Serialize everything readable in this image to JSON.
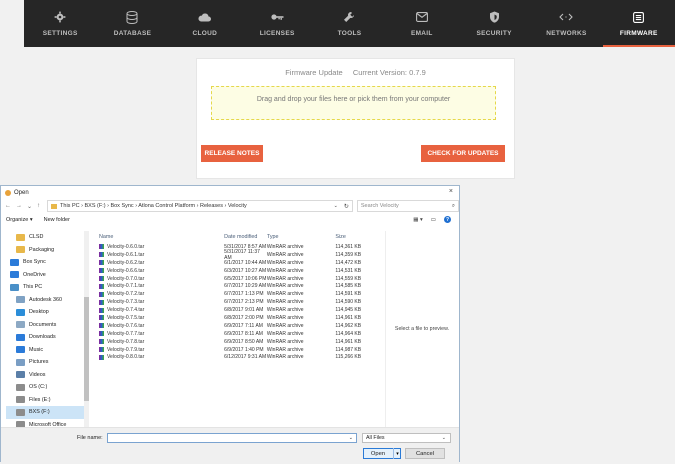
{
  "nav": {
    "items": [
      {
        "label": "SETTINGS",
        "icon": "gear-icon"
      },
      {
        "label": "DATABASE",
        "icon": "database-icon"
      },
      {
        "label": "CLOUD",
        "icon": "cloud-icon"
      },
      {
        "label": "LICENSES",
        "icon": "key-icon"
      },
      {
        "label": "TOOLS",
        "icon": "wrench-icon"
      },
      {
        "label": "EMAIL",
        "icon": "envelope-icon"
      },
      {
        "label": "SECURITY",
        "icon": "shield-icon"
      },
      {
        "label": "NETWORKS",
        "icon": "code-arrows-icon"
      },
      {
        "label": "FIRMWARE",
        "icon": "chip-icon"
      }
    ],
    "active": "FIRMWARE",
    "accent": "#e8623f"
  },
  "firmware": {
    "title": "Firmware Update",
    "version_label": "Current Version: 0.7.9",
    "drop_text": "Drag and drop your files here or pick them from your computer",
    "release_notes": "RELEASE NOTES",
    "check_updates": "CHECK FOR UPDATES"
  },
  "dialog": {
    "title": "Open",
    "close": "×",
    "breadcrumb": "This PC  ›  BXS (F:)  ›  Box Sync  ›  Atlona Control Platform  ›  Releases  ›  Velocity",
    "search_placeholder": "Search Velocity",
    "organize": "Organize ▾",
    "new_folder": "New folder",
    "nav_pane": [
      {
        "label": "CLSD",
        "icon": "folder-icon",
        "color": "#e8b84a",
        "indent": true
      },
      {
        "label": "Packaging",
        "icon": "folder-icon",
        "color": "#e8b84a",
        "indent": true
      },
      {
        "label": "Box Sync",
        "icon": "box-icon",
        "color": "#2b7bd9",
        "indent": false
      },
      {
        "label": "OneDrive",
        "icon": "onedrive-icon",
        "color": "#2b7bd9",
        "indent": false
      },
      {
        "label": "This PC",
        "icon": "pc-icon",
        "color": "#4a90c8",
        "indent": false
      },
      {
        "label": "Autodesk 360",
        "icon": "cloud-icon",
        "color": "#7fa2c4",
        "indent": true
      },
      {
        "label": "Desktop",
        "icon": "desktop-icon",
        "color": "#2b8ed9",
        "indent": true
      },
      {
        "label": "Documents",
        "icon": "documents-icon",
        "color": "#8da9c4",
        "indent": true
      },
      {
        "label": "Downloads",
        "icon": "downloads-icon",
        "color": "#2b7bd9",
        "indent": true
      },
      {
        "label": "Music",
        "icon": "music-icon",
        "color": "#2b7bd9",
        "indent": true
      },
      {
        "label": "Pictures",
        "icon": "pictures-icon",
        "color": "#7a9ec4",
        "indent": true
      },
      {
        "label": "Videos",
        "icon": "videos-icon",
        "color": "#5b7fa8",
        "indent": true
      },
      {
        "label": "OS (C:)",
        "icon": "drive-icon",
        "color": "#8c8c8c",
        "indent": true
      },
      {
        "label": "Files (E:)",
        "icon": "drive-icon",
        "color": "#8c8c8c",
        "indent": true
      },
      {
        "label": "BXS (F:)",
        "icon": "drive-icon",
        "color": "#8c8c8c",
        "indent": true,
        "selected": true
      },
      {
        "label": "Microsoft Office",
        "icon": "drive-icon",
        "color": "#8c8c8c",
        "indent": true
      }
    ],
    "columns": {
      "name": "Name",
      "date": "Date modified",
      "type": "Type",
      "size": "Size"
    },
    "files": [
      {
        "name": "Velocity-0.6.0.tar",
        "date": "5/31/2017 8:57 AM",
        "type": "WinRAR archive",
        "size": "114,361 KB"
      },
      {
        "name": "Velocity-0.6.1.tar",
        "date": "5/31/2017 11:37 AM",
        "type": "WinRAR archive",
        "size": "114,359 KB"
      },
      {
        "name": "Velocity-0.6.2.tar",
        "date": "6/1/2017 10:44 AM",
        "type": "WinRAR archive",
        "size": "114,472 KB"
      },
      {
        "name": "Velocity-0.6.6.tar",
        "date": "6/3/2017 10:27 AM",
        "type": "WinRAR archive",
        "size": "114,531 KB"
      },
      {
        "name": "Velocity-0.7.0.tar",
        "date": "6/5/2017 10:06 PM",
        "type": "WinRAR archive",
        "size": "114,559 KB"
      },
      {
        "name": "Velocity-0.7.1.tar",
        "date": "6/7/2017 10:29 AM",
        "type": "WinRAR archive",
        "size": "114,585 KB"
      },
      {
        "name": "Velocity-0.7.2.tar",
        "date": "6/7/2017 1:13 PM",
        "type": "WinRAR archive",
        "size": "114,591 KB"
      },
      {
        "name": "Velocity-0.7.3.tar",
        "date": "6/7/2017 2:13 PM",
        "type": "WinRAR archive",
        "size": "114,590 KB"
      },
      {
        "name": "Velocity-0.7.4.tar",
        "date": "6/8/2017 9:01 AM",
        "type": "WinRAR archive",
        "size": "114,945 KB"
      },
      {
        "name": "Velocity-0.7.5.tar",
        "date": "6/8/2017 2:00 PM",
        "type": "WinRAR archive",
        "size": "114,961 KB"
      },
      {
        "name": "Velocity-0.7.6.tar",
        "date": "6/9/2017 7:11 AM",
        "type": "WinRAR archive",
        "size": "114,962 KB"
      },
      {
        "name": "Velocity-0.7.7.tar",
        "date": "6/9/2017 8:11 AM",
        "type": "WinRAR archive",
        "size": "114,964 KB"
      },
      {
        "name": "Velocity-0.7.8.tar",
        "date": "6/9/2017 8:50 AM",
        "type": "WinRAR archive",
        "size": "114,961 KB"
      },
      {
        "name": "Velocity-0.7.9.tar",
        "date": "6/9/2017 1:40 PM",
        "type": "WinRAR archive",
        "size": "114,987 KB"
      },
      {
        "name": "Velocity-0.8.0.tar",
        "date": "6/12/2017 9:31 AM",
        "type": "WinRAR archive",
        "size": "115,266 KB"
      }
    ],
    "preview_text": "Select a file to preview.",
    "filename_label": "File name:",
    "filename_value": "",
    "filetype": "All Files",
    "open": "Open",
    "cancel": "Cancel"
  }
}
